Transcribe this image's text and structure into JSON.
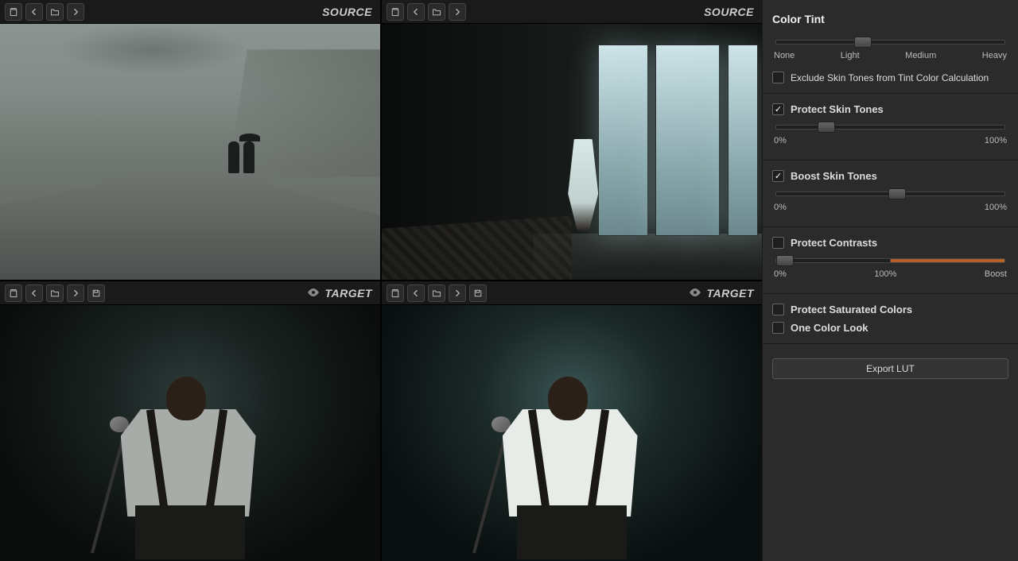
{
  "panels": {
    "sourceA": {
      "label": "SOURCE"
    },
    "sourceB": {
      "label": "SOURCE"
    },
    "targetA": {
      "label": "TARGET"
    },
    "targetB": {
      "label": "TARGET"
    }
  },
  "sidebar": {
    "colorTint": {
      "title": "Color Tint",
      "ticks": [
        "None",
        "Light",
        "Medium",
        "Heavy"
      ],
      "valuePct": 38
    },
    "excludeSkin": {
      "label": "Exclude Skin Tones from Tint Color Calculation",
      "checked": false
    },
    "protectSkin": {
      "title": "Protect Skin Tones",
      "checked": true,
      "min": "0%",
      "max": "100%",
      "valuePct": 22
    },
    "boostSkin": {
      "title": "Boost Skin Tones",
      "checked": true,
      "min": "0%",
      "max": "100%",
      "valuePct": 53
    },
    "protectContrasts": {
      "title": "Protect Contrasts",
      "checked": false,
      "min": "0%",
      "mid": "100%",
      "max": "Boost",
      "valuePct": 4
    },
    "protectSaturated": {
      "title": "Protect Saturated Colors",
      "checked": false
    },
    "oneColor": {
      "title": "One Color Look",
      "checked": false
    },
    "exportBtn": "Export LUT"
  }
}
